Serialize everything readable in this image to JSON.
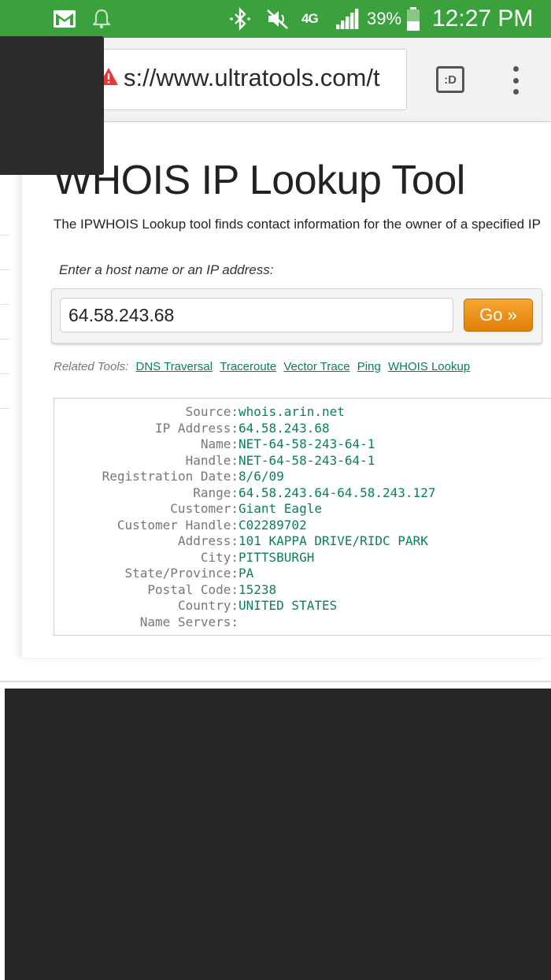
{
  "status_bar": {
    "battery": "39%",
    "time": "12:27 PM",
    "network": "4G",
    "icons": [
      "gmail-icon",
      "bell-icon",
      "bluetooth-icon",
      "mute-icon",
      "signal-icon",
      "battery-icon"
    ]
  },
  "browser": {
    "url": "s://www.ultratools.com/t",
    "tabs_label": ":D"
  },
  "page": {
    "title": "WHOIS IP Lookup Tool",
    "description": "The IPWHOIS Lookup tool finds contact information for the owner of a specified IP",
    "form_label": "Enter a host name or an IP address:",
    "input_value": "64.58.243.68",
    "go_label": "Go »",
    "related_label": "Related Tools:",
    "related_links": [
      "DNS Traversal",
      "Traceroute",
      "Vector Trace",
      "Ping",
      "WHOIS Lookup"
    ]
  },
  "results": [
    {
      "key": "Source:",
      "value": "whois.arin.net"
    },
    {
      "key": "IP Address:",
      "value": "64.58.243.68"
    },
    {
      "key": "Name:",
      "value": "NET-64-58-243-64-1"
    },
    {
      "key": "Handle:",
      "value": "NET-64-58-243-64-1"
    },
    {
      "key": "Registration Date:",
      "value": "8/6/09"
    },
    {
      "key": "Range:",
      "value": "64.58.243.64-64.58.243.127"
    },
    {
      "key": "Customer:",
      "value": "Giant Eagle"
    },
    {
      "key": "Customer Handle:",
      "value": "C02289702"
    },
    {
      "key": "Address:",
      "value": "101 KAPPA DRIVE/RIDC PARK"
    },
    {
      "key": "City:",
      "value": "PITTSBURGH"
    },
    {
      "key": "State/Province:",
      "value": "PA"
    },
    {
      "key": "Postal Code:",
      "value": "15238"
    },
    {
      "key": "Country:",
      "value": "UNITED STATES"
    },
    {
      "key": "Name Servers:",
      "value": ""
    }
  ],
  "colors": {
    "status_bar": "#3aa13c",
    "link": "#0a7f5c",
    "go_button": "#ee9118",
    "warning": "#e53935"
  }
}
